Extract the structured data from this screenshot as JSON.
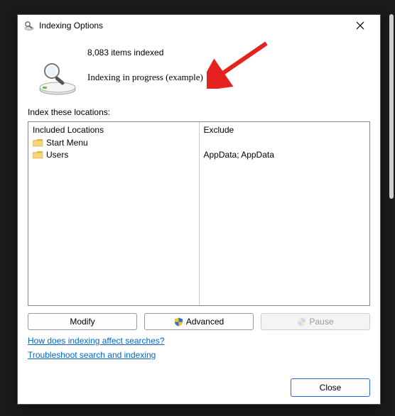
{
  "window": {
    "title": "Indexing Options"
  },
  "status": {
    "count_line": "8,083 items indexed",
    "progress_line": "Indexing in progress (example)"
  },
  "locations": {
    "section_label": "Index these locations:",
    "included_header": "Included Locations",
    "exclude_header": "Exclude",
    "rows": [
      {
        "name": "Start Menu",
        "exclude": ""
      },
      {
        "name": "Users",
        "exclude": "AppData; AppData"
      }
    ]
  },
  "buttons": {
    "modify": "Modify",
    "advanced": "Advanced",
    "pause": "Pause",
    "close": "Close"
  },
  "links": {
    "affect": "How does indexing affect searches?",
    "troubleshoot": "Troubleshoot search and indexing"
  }
}
